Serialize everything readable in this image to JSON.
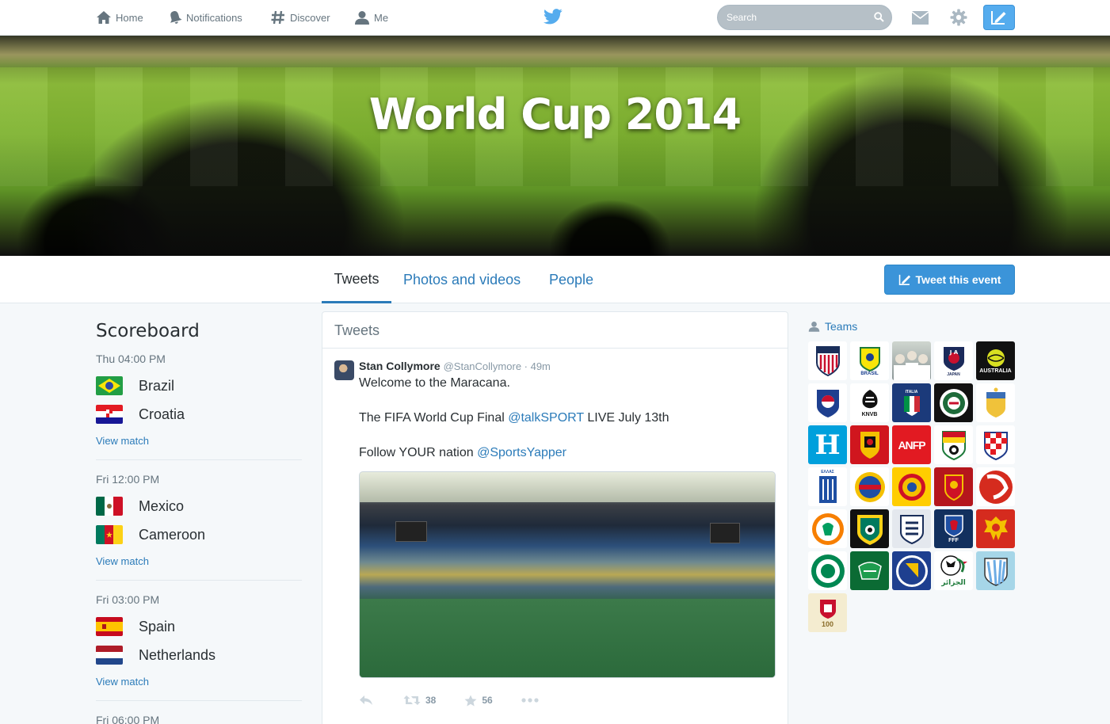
{
  "nav": {
    "home": "Home",
    "notifications": "Notifications",
    "discover": "Discover",
    "me": "Me",
    "search_placeholder": "Search"
  },
  "banner": {
    "title": "World Cup 2014"
  },
  "tabs": [
    {
      "label": "Tweets",
      "active": true
    },
    {
      "label": "Photos and videos",
      "active": false
    },
    {
      "label": "People",
      "active": false
    }
  ],
  "tweet_event_label": "Tweet this event",
  "scoreboard": {
    "title": "Scoreboard",
    "view_match_label": "View match",
    "matches": [
      {
        "time": "Thu 04:00 PM",
        "team1": "Brazil",
        "team2": "Croatia"
      },
      {
        "time": "Fri 12:00 PM",
        "team1": "Mexico",
        "team2": "Cameroon"
      },
      {
        "time": "Fri 03:00 PM",
        "team1": "Spain",
        "team2": "Netherlands"
      },
      {
        "time": "Fri 06:00 PM"
      }
    ]
  },
  "timeline": {
    "title": "Tweets",
    "tweet": {
      "name": "Stan Collymore",
      "meta": "@StanCollymore · 49m",
      "line1": "Welcome to the Maracana.",
      "line2_pre": "The FIFA World Cup Final ",
      "line2_mention": "@talkSPORT",
      "line2_post": " LIVE July 13th",
      "line3_pre": "Follow YOUR nation ",
      "line3_mention": "@SportsYapper",
      "retweets": "38",
      "favorites": "56"
    }
  },
  "teams": {
    "label": "Teams",
    "tiles": [
      {
        "name": "usa"
      },
      {
        "name": "brazil",
        "text": "BRASIL"
      },
      {
        "name": "germany"
      },
      {
        "name": "japan",
        "text": "JAPAN"
      },
      {
        "name": "australia",
        "text": "AUSTRALIA"
      },
      {
        "name": "korea"
      },
      {
        "name": "netherlands",
        "text": "KNVB"
      },
      {
        "name": "italy",
        "text": "ITALIA"
      },
      {
        "name": "mexico"
      },
      {
        "name": "uruguay"
      },
      {
        "name": "honduras",
        "text": "H"
      },
      {
        "name": "belgium"
      },
      {
        "name": "chile",
        "text": "ANFP"
      },
      {
        "name": "ghana"
      },
      {
        "name": "croatia"
      },
      {
        "name": "greece",
        "text": "ΕΛΛΑΣ"
      },
      {
        "name": "costa-rica"
      },
      {
        "name": "colombia"
      },
      {
        "name": "spain"
      },
      {
        "name": "switzerland"
      },
      {
        "name": "ivory-coast"
      },
      {
        "name": "cameroon"
      },
      {
        "name": "england"
      },
      {
        "name": "france",
        "text": "FFF"
      },
      {
        "name": "russia"
      },
      {
        "name": "nigeria"
      },
      {
        "name": "iran"
      },
      {
        "name": "bosnia"
      },
      {
        "name": "algeria",
        "text": "الجزائر"
      },
      {
        "name": "argentina"
      },
      {
        "name": "portugal",
        "text": "100"
      }
    ]
  }
}
